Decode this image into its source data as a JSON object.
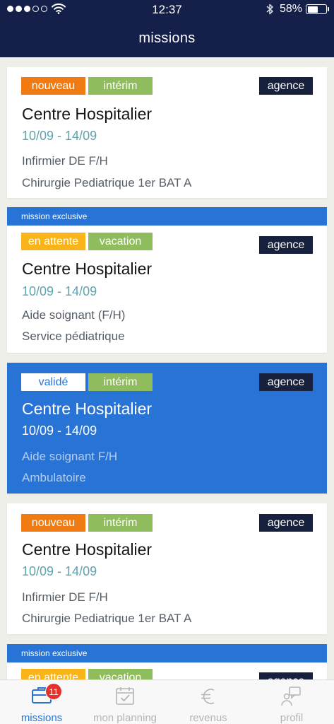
{
  "status": {
    "time": "12:37",
    "battery": "58%",
    "battery_level": 0.58
  },
  "header": {
    "title": "missions"
  },
  "cards": [
    {
      "exclusive_label": "",
      "status_tag": "nouveau",
      "type_tag": "intérim",
      "agency_tag": "agence",
      "title": "Centre Hospitalier",
      "dates": "10/09 - 14/09",
      "role": "Infirmier DE F/H",
      "service": "Chirurgie Pediatrique 1er BAT A"
    },
    {
      "exclusive_label": "mission exclusive",
      "status_tag": "en attente",
      "type_tag": "vacation",
      "agency_tag": "agence",
      "title": "Centre Hospitalier",
      "dates": "10/09 - 14/09",
      "role": "Aide soignant (F/H)",
      "service": "Service pédiatrique"
    },
    {
      "exclusive_label": "",
      "status_tag": "validé",
      "type_tag": "intérim",
      "agency_tag": "agence",
      "title": "Centre Hospitalier",
      "dates": "10/09 - 14/09",
      "role": "Aide soignant F/H",
      "service": "Ambulatoire"
    },
    {
      "exclusive_label": "",
      "status_tag": "nouveau",
      "type_tag": "intérim",
      "agency_tag": "agence",
      "title": "Centre Hospitalier",
      "dates": "10/09 - 14/09",
      "role": "Infirmier DE F/H",
      "service": "Chirurgie Pediatrique 1er BAT A"
    },
    {
      "exclusive_label": "mission exclusive",
      "status_tag": "en attente",
      "type_tag": "vacation",
      "agency_tag": "agence"
    }
  ],
  "tabbar": {
    "tabs": [
      {
        "label": "missions",
        "icon": "briefcase-icon",
        "badge": "11"
      },
      {
        "label": "mon planning",
        "icon": "calendar-check-icon"
      },
      {
        "label": "revenus",
        "icon": "euro-icon"
      },
      {
        "label": "profil",
        "icon": "user-chat-icon"
      }
    ]
  },
  "colors": {
    "navbar": "#14204a",
    "accent": "#2874d6",
    "tag_new": "#f07b12",
    "tag_interim": "#8fbc5c",
    "tag_waiting": "#f8b418",
    "tag_agency": "#17213d",
    "dates": "#5fa3ae",
    "badge": "#e5302b"
  }
}
